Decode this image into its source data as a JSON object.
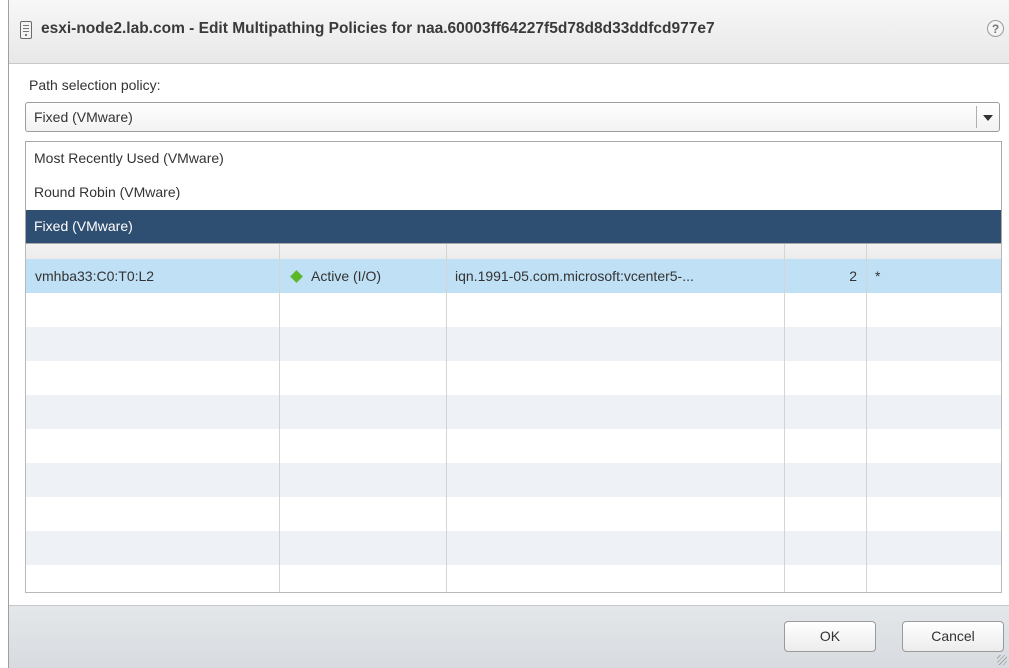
{
  "dialog": {
    "title": "esxi-node2.lab.com - Edit Multipathing Policies for naa.60003ff64227f5d78d8d33ddfcd977e7",
    "help_icon": "?"
  },
  "policy": {
    "label": "Path selection policy:",
    "selected": "Fixed (VMware)",
    "options": [
      "Most Recently Used (VMware)",
      "Round Robin (VMware)",
      "Fixed (VMware)"
    ]
  },
  "table": {
    "rows": [
      {
        "runtime_name": "vmhba33:C0:T0:L2",
        "status": "Active (I/O)",
        "target": "iqn.1991-05.com.microsoft:vcenter5-...",
        "lun": "2",
        "preferred": "*"
      }
    ]
  },
  "footer": {
    "ok_label": "OK",
    "cancel_label": "Cancel"
  },
  "colors": {
    "selected_option": "#2e4e72",
    "selected_row": "#bfe0f5",
    "active_status": "#5cb82a"
  }
}
